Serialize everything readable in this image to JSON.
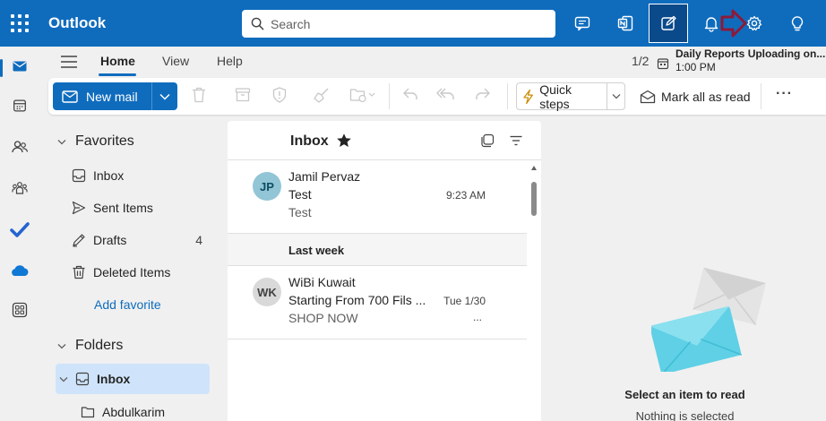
{
  "app": {
    "title": "Outlook",
    "accent_color": "#0f6cbd"
  },
  "search": {
    "placeholder": "Search"
  },
  "topbar_icons": [
    "chat-icon",
    "onenote-icon",
    "notes-icon",
    "bell-icon",
    "gear-icon",
    "lightbulb-icon"
  ],
  "notification": {
    "title": "Daily Reports Uploading on...",
    "time": "1:00 PM",
    "pager": "1/2"
  },
  "ribbon_tabs": [
    "Home",
    "View",
    "Help"
  ],
  "ribbon": {
    "new_mail": "New mail",
    "quick_steps": "Quick steps",
    "mark_all_read": "Mark all as read",
    "more": "···"
  },
  "favorites": {
    "heading": "Favorites",
    "items": [
      {
        "label": "Inbox",
        "count": ""
      },
      {
        "label": "Sent Items",
        "count": ""
      },
      {
        "label": "Drafts",
        "count": "4"
      },
      {
        "label": "Deleted Items",
        "count": ""
      }
    ],
    "add_label": "Add favorite"
  },
  "folders": {
    "heading": "Folders",
    "items": [
      {
        "label": "Inbox"
      },
      {
        "label": "Abdulkarim"
      }
    ]
  },
  "message_list": {
    "title": "Inbox",
    "messages": [
      {
        "initials": "JP",
        "from": "Jamil Pervaz",
        "subject": "Test",
        "preview": "Test",
        "time": "9:23 AM",
        "avatar_color": "#92c5d6"
      },
      {
        "initials": "WK",
        "from": "WiBi Kuwait",
        "subject": "Starting From 700 Fils ...",
        "preview": "SHOP NOW",
        "time": "Tue 1/30",
        "extra": "...",
        "avatar_color": "#d9d9d9"
      }
    ],
    "group_label": "Last week"
  },
  "reading_pane": {
    "title": "Select an item to read",
    "subtitle": "Nothing is selected"
  }
}
